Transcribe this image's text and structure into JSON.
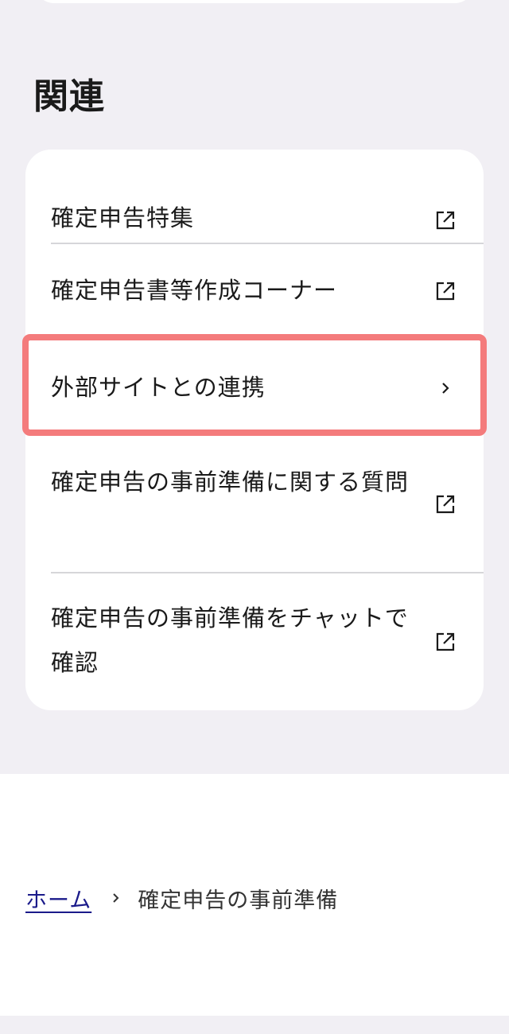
{
  "related": {
    "heading": "関連",
    "items": [
      {
        "label": "確定申告特集",
        "icon": "external-link-icon"
      },
      {
        "label": "確定申告書等作成コーナー",
        "icon": "external-link-icon"
      },
      {
        "label": "外部サイトとの連携",
        "icon": "chevron-right-icon"
      },
      {
        "label": "確定申告の事前準備に関する質問",
        "icon": "external-link-icon"
      },
      {
        "label": "確定申告の事前準備をチャットで確認",
        "icon": "external-link-icon"
      }
    ]
  },
  "breadcrumb": {
    "home": "ホーム",
    "current": "確定申告の事前準備"
  },
  "colors": {
    "section_background": "#f1eff4",
    "card_background": "#ffffff",
    "highlight_border": "#f47b7c",
    "link": "#1a1a8a"
  }
}
